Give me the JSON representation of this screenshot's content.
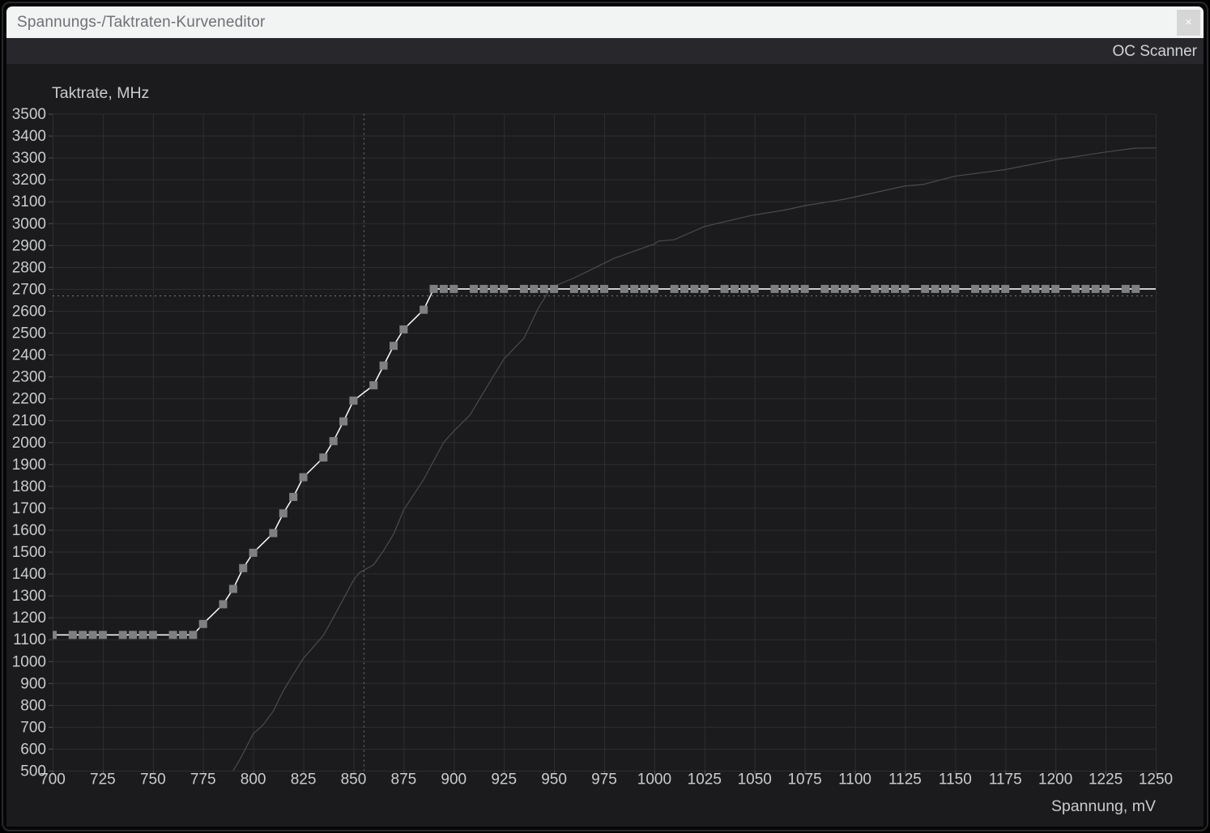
{
  "window": {
    "title": "Spannungs-/Taktraten-Kurveneditor"
  },
  "icons": {
    "close": "×"
  },
  "toolbar": {
    "oc_scanner_label": "OC Scanner"
  },
  "colors": {
    "titlebar_bg": "#f2f3f3",
    "titlebar_text": "#6e7276",
    "close_btn_bg": "#d6d6d6",
    "toolbar_bg": "#28282c",
    "toolbar_text": "#d2d3d5",
    "chart_bg": "#1b1b1d",
    "grid": "#2e2e30",
    "tick_stub": "#515153",
    "tick_text": "#c9cbcd",
    "crosshair": "#7a7b7d",
    "editable_curve": "#f3f3f3",
    "editable_marker": "#7e7f81",
    "reference_curve": "#4b4b4d"
  },
  "chart_data": {
    "type": "line",
    "title": "",
    "xlabel": "Spannung, mV",
    "ylabel": "Taktrate, MHz",
    "xlim": [
      700,
      1250
    ],
    "ylim": [
      500,
      3500
    ],
    "x_tick_step": 25,
    "y_tick_step": 100,
    "grid": true,
    "legend_position": "none",
    "crosshair": {
      "x": 855,
      "y": 2670
    },
    "series": [
      {
        "name": "vf-curve-editable",
        "type": "line+markers",
        "marker": "square",
        "marker_size": 10,
        "points": [
          [
            700,
            1120
          ],
          [
            710,
            1120
          ],
          [
            715,
            1120
          ],
          [
            720,
            1120
          ],
          [
            725,
            1120
          ],
          [
            735,
            1120
          ],
          [
            740,
            1120
          ],
          [
            745,
            1120
          ],
          [
            750,
            1120
          ],
          [
            760,
            1120
          ],
          [
            765,
            1120
          ],
          [
            770,
            1120
          ],
          [
            775,
            1170
          ],
          [
            785,
            1260
          ],
          [
            790,
            1330
          ],
          [
            795,
            1425
          ],
          [
            800,
            1495
          ],
          [
            810,
            1585
          ],
          [
            815,
            1675
          ],
          [
            820,
            1750
          ],
          [
            825,
            1840
          ],
          [
            835,
            1930
          ],
          [
            840,
            2005
          ],
          [
            845,
            2095
          ],
          [
            850,
            2190
          ],
          [
            860,
            2260
          ],
          [
            865,
            2350
          ],
          [
            870,
            2440
          ],
          [
            875,
            2515
          ],
          [
            885,
            2605
          ],
          [
            890,
            2700
          ],
          [
            895,
            2700
          ],
          [
            900,
            2700
          ],
          [
            910,
            2700
          ],
          [
            915,
            2700
          ],
          [
            920,
            2700
          ],
          [
            925,
            2700
          ],
          [
            935,
            2700
          ],
          [
            940,
            2700
          ],
          [
            945,
            2700
          ],
          [
            950,
            2700
          ],
          [
            960,
            2700
          ],
          [
            965,
            2700
          ],
          [
            970,
            2700
          ],
          [
            975,
            2700
          ],
          [
            985,
            2700
          ],
          [
            990,
            2700
          ],
          [
            995,
            2700
          ],
          [
            1000,
            2700
          ],
          [
            1010,
            2700
          ],
          [
            1015,
            2700
          ],
          [
            1020,
            2700
          ],
          [
            1025,
            2700
          ],
          [
            1035,
            2700
          ],
          [
            1040,
            2700
          ],
          [
            1045,
            2700
          ],
          [
            1050,
            2700
          ],
          [
            1060,
            2700
          ],
          [
            1065,
            2700
          ],
          [
            1070,
            2700
          ],
          [
            1075,
            2700
          ],
          [
            1085,
            2700
          ],
          [
            1090,
            2700
          ],
          [
            1095,
            2700
          ],
          [
            1100,
            2700
          ],
          [
            1110,
            2700
          ],
          [
            1115,
            2700
          ],
          [
            1120,
            2700
          ],
          [
            1125,
            2700
          ],
          [
            1135,
            2700
          ],
          [
            1140,
            2700
          ],
          [
            1145,
            2700
          ],
          [
            1150,
            2700
          ],
          [
            1160,
            2700
          ],
          [
            1165,
            2700
          ],
          [
            1170,
            2700
          ],
          [
            1175,
            2700
          ],
          [
            1185,
            2700
          ],
          [
            1190,
            2700
          ],
          [
            1195,
            2700
          ],
          [
            1200,
            2700
          ],
          [
            1210,
            2700
          ],
          [
            1215,
            2700
          ],
          [
            1220,
            2700
          ],
          [
            1225,
            2700
          ],
          [
            1235,
            2700
          ],
          [
            1240,
            2700
          ]
        ],
        "line_extension": [
          1250,
          2700
        ]
      },
      {
        "name": "vf-curve-reference",
        "type": "line",
        "marker": "none",
        "points": [
          [
            790,
            500
          ],
          [
            793,
            545
          ],
          [
            795,
            580
          ],
          [
            800,
            668
          ],
          [
            805,
            710
          ],
          [
            810,
            772
          ],
          [
            815,
            865
          ],
          [
            820,
            940
          ],
          [
            825,
            1013
          ],
          [
            830,
            1065
          ],
          [
            835,
            1118
          ],
          [
            840,
            1200
          ],
          [
            845,
            1285
          ],
          [
            850,
            1370
          ],
          [
            853,
            1405
          ],
          [
            857,
            1425
          ],
          [
            860,
            1440
          ],
          [
            865,
            1505
          ],
          [
            870,
            1580
          ],
          [
            875,
            1690
          ],
          [
            880,
            1760
          ],
          [
            885,
            1830
          ],
          [
            890,
            1915
          ],
          [
            895,
            2000
          ],
          [
            900,
            2050
          ],
          [
            908,
            2123
          ],
          [
            915,
            2230
          ],
          [
            925,
            2380
          ],
          [
            935,
            2475
          ],
          [
            942,
            2610
          ],
          [
            948,
            2700
          ],
          [
            952,
            2720
          ],
          [
            960,
            2750
          ],
          [
            970,
            2795
          ],
          [
            980,
            2840
          ],
          [
            1000,
            2905
          ],
          [
            1002,
            2918
          ],
          [
            1010,
            2925
          ],
          [
            1025,
            2985
          ],
          [
            1048,
            3035
          ],
          [
            1065,
            3060
          ],
          [
            1075,
            3080
          ],
          [
            1095,
            3110
          ],
          [
            1125,
            3170
          ],
          [
            1134,
            3177
          ],
          [
            1150,
            3215
          ],
          [
            1175,
            3245
          ],
          [
            1185,
            3263
          ],
          [
            1200,
            3290
          ],
          [
            1225,
            3325
          ],
          [
            1240,
            3343
          ],
          [
            1250,
            3344
          ]
        ]
      }
    ]
  }
}
